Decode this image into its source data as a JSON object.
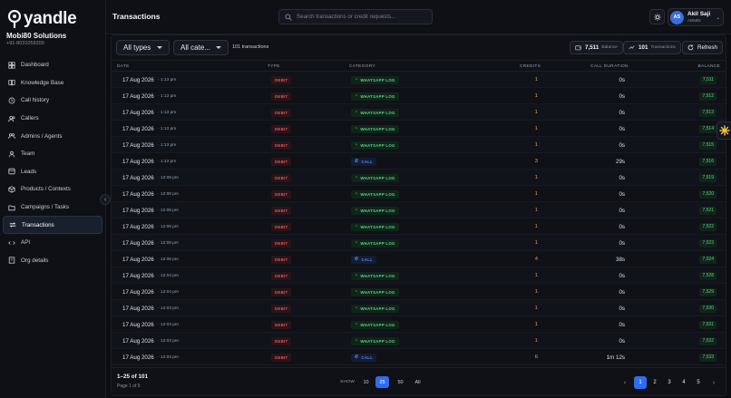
{
  "brand": {
    "logo_text": "yandle",
    "org_name": "Mobi80 Solutions",
    "org_phone": "+91-8031059200"
  },
  "nav": [
    {
      "key": "dashboard",
      "label": "Dashboard",
      "icon": "dashboard-icon"
    },
    {
      "key": "knowledge",
      "label": "Knowledge Base",
      "icon": "book-icon"
    },
    {
      "key": "call-history",
      "label": "Call history",
      "icon": "history-icon"
    },
    {
      "key": "callers",
      "label": "Callers",
      "icon": "users-icon"
    },
    {
      "key": "admins",
      "label": "Admins / Agents",
      "icon": "user-group-icon"
    },
    {
      "key": "team",
      "label": "Team",
      "icon": "team-icon"
    },
    {
      "key": "leads",
      "label": "Leads",
      "icon": "leads-icon"
    },
    {
      "key": "products",
      "label": "Products / Contexts",
      "icon": "box-icon"
    },
    {
      "key": "campaigns",
      "label": "Campaigns / Tasks",
      "icon": "folder-icon"
    },
    {
      "key": "transactions",
      "label": "Transactions",
      "icon": "swap-icon",
      "active": true
    },
    {
      "key": "api",
      "label": "API",
      "icon": "api-icon"
    },
    {
      "key": "org",
      "label": "Org details",
      "icon": "org-icon"
    }
  ],
  "header": {
    "title": "Transactions",
    "search_placeholder": "Search transactions or credit requests...",
    "user": {
      "initials": "AS",
      "name": "Akil Saji",
      "role": "ADMIN"
    }
  },
  "toolbar": {
    "type_filter": "All types",
    "category_filter": "All cate...",
    "count_text": "101 transactions",
    "balance_value": "7,511",
    "balance_label": "Balance",
    "transactions_value": "101",
    "transactions_label": "Transactions",
    "refresh_label": "Refresh"
  },
  "table": {
    "columns": {
      "date": "DATE",
      "type": "TYPE",
      "category": "CATEGORY",
      "credits": "CREDITS",
      "duration": "CALL DURATION",
      "balance": "BALANCE"
    },
    "rows": [
      {
        "date": "17 Aug 2026",
        "time": "· 1:13 pm",
        "type": "DEBIT",
        "category": "WHATSAPP LOG",
        "cat": "wa",
        "credits": "1",
        "duration": "0s",
        "balance": "7,511"
      },
      {
        "date": "17 Aug 2026",
        "time": "· 1:13 pm",
        "type": "DEBIT",
        "category": "WHATSAPP LOG",
        "cat": "wa",
        "credits": "1",
        "duration": "0s",
        "balance": "7,512"
      },
      {
        "date": "17 Aug 2026",
        "time": "· 1:13 pm",
        "type": "DEBIT",
        "category": "WHATSAPP LOG",
        "cat": "wa",
        "credits": "1",
        "duration": "0s",
        "balance": "7,513"
      },
      {
        "date": "17 Aug 2026",
        "time": "· 1:13 pm",
        "type": "DEBIT",
        "category": "WHATSAPP LOG",
        "cat": "wa",
        "credits": "1",
        "duration": "0s",
        "balance": "7,514"
      },
      {
        "date": "17 Aug 2026",
        "time": "· 1:13 pm",
        "type": "DEBIT",
        "category": "WHATSAPP LOG",
        "cat": "wa",
        "credits": "1",
        "duration": "0s",
        "balance": "7,515"
      },
      {
        "date": "17 Aug 2026",
        "time": "· 1:13 pm",
        "type": "DEBIT",
        "category": "CALL",
        "cat": "call",
        "credits": "3",
        "duration": "29s",
        "balance": "7,516"
      },
      {
        "date": "17 Aug 2026",
        "time": "· 12:09 pm",
        "type": "DEBIT",
        "category": "WHATSAPP LOG",
        "cat": "wa",
        "credits": "1",
        "duration": "0s",
        "balance": "7,519"
      },
      {
        "date": "17 Aug 2026",
        "time": "· 12:08 pm",
        "type": "DEBIT",
        "category": "WHATSAPP LOG",
        "cat": "wa",
        "credits": "1",
        "duration": "0s",
        "balance": "7,520"
      },
      {
        "date": "17 Aug 2026",
        "time": "· 12:08 pm",
        "type": "DEBIT",
        "category": "WHATSAPP LOG",
        "cat": "wa",
        "credits": "1",
        "duration": "0s",
        "balance": "7,521"
      },
      {
        "date": "17 Aug 2026",
        "time": "· 12:08 pm",
        "type": "DEBIT",
        "category": "WHATSAPP LOG",
        "cat": "wa",
        "credits": "1",
        "duration": "0s",
        "balance": "7,522"
      },
      {
        "date": "17 Aug 2026",
        "time": "· 12:08 pm",
        "type": "DEBIT",
        "category": "WHATSAPP LOG",
        "cat": "wa",
        "credits": "1",
        "duration": "0s",
        "balance": "7,523"
      },
      {
        "date": "17 Aug 2026",
        "time": "· 12:08 pm",
        "type": "DEBIT",
        "category": "CALL",
        "cat": "call",
        "credits": "4",
        "duration": "38s",
        "balance": "7,524"
      },
      {
        "date": "17 Aug 2026",
        "time": "· 12:04 pm",
        "type": "DEBIT",
        "category": "WHATSAPP LOG",
        "cat": "wa",
        "credits": "1",
        "duration": "0s",
        "balance": "7,528"
      },
      {
        "date": "17 Aug 2026",
        "time": "· 12:04 pm",
        "type": "DEBIT",
        "category": "WHATSAPP LOG",
        "cat": "wa",
        "credits": "1",
        "duration": "0s",
        "balance": "7,529"
      },
      {
        "date": "17 Aug 2026",
        "time": "· 12:03 pm",
        "type": "DEBIT",
        "category": "WHATSAPP LOG",
        "cat": "wa",
        "credits": "1",
        "duration": "0s",
        "balance": "7,530"
      },
      {
        "date": "17 Aug 2026",
        "time": "· 12:03 pm",
        "type": "DEBIT",
        "category": "WHATSAPP LOG",
        "cat": "wa",
        "credits": "1",
        "duration": "0s",
        "balance": "7,531"
      },
      {
        "date": "17 Aug 2026",
        "time": "· 12:03 pm",
        "type": "DEBIT",
        "category": "WHATSAPP LOG",
        "cat": "wa",
        "credits": "1",
        "duration": "0s",
        "balance": "7,532"
      },
      {
        "date": "17 Aug 2026",
        "time": "· 12:03 pm",
        "type": "DEBIT",
        "category": "CALL",
        "cat": "call",
        "credits": "6",
        "duration": "1m 12s",
        "balance": "7,533"
      }
    ]
  },
  "footer": {
    "range": "1–25 of 101",
    "page_of": "Page 1 of 5",
    "show_label": "SHOW",
    "page_sizes": [
      "10",
      "25",
      "50",
      "All"
    ],
    "active_size": "25",
    "pages": [
      "1",
      "2",
      "3",
      "4",
      "5"
    ],
    "active_page": "1"
  },
  "colors": {
    "accent": "#2f6df0",
    "debit": "#e0565b",
    "whatsapp": "#5fd28a",
    "call": "#5b8ef0",
    "credits": "#e8a13a"
  }
}
